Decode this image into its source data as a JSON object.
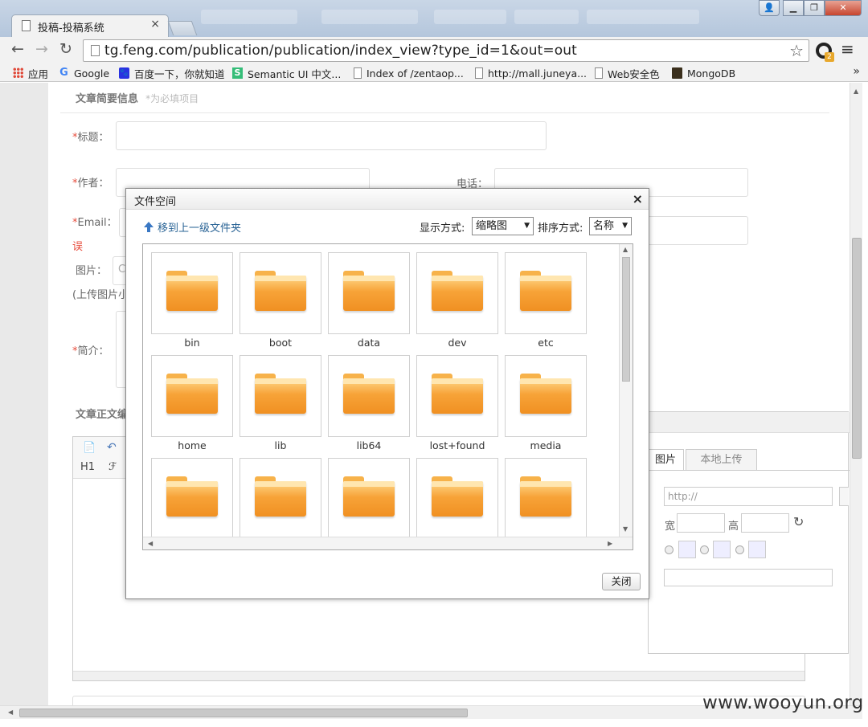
{
  "browser": {
    "tab_title": "投稿-投稿系统",
    "url": "tg.feng.com/publication/publication/index_view?type_id=1&out=out",
    "bookmarks": [
      {
        "label": "应用",
        "icon": "apps-grid-icon"
      },
      {
        "label": "Google",
        "icon": "google-icon"
      },
      {
        "label": "百度一下，你就知道",
        "icon": "baidu-icon"
      },
      {
        "label": "Semantic UI 中文...",
        "icon": "semantic-ui-icon"
      },
      {
        "label": "Index of /zentaop...",
        "icon": "page-icon"
      },
      {
        "label": "http://mall.juneya...",
        "icon": "page-icon"
      },
      {
        "label": "Web安全色",
        "icon": "page-icon"
      },
      {
        "label": "MongoDB",
        "icon": "mongodb-icon"
      }
    ],
    "bookmarks_more": "»"
  },
  "form": {
    "section_title": "文章简要信息",
    "section_hint": "*为必填项目",
    "title_label": "标题：",
    "author_label": "作者：",
    "phone_label": "电话：",
    "email_label": "Email：",
    "error_text": "误",
    "image_label": "图片：",
    "image_input_partial": "C",
    "upload_hint_partial": "(上传图片小",
    "intro_label": "简介：",
    "body_section_partial": "文章正文编",
    "editor_heading_btn": "H1",
    "editor_font_btn": "ℱ"
  },
  "image_dialog": {
    "tab_network_partial": "图片",
    "tab_local_upload": "本地上传",
    "url_placeholder": "http://",
    "width_label": "宽",
    "height_label": "高"
  },
  "file_dialog": {
    "title": "文件空间",
    "close_glyph": "×",
    "up_folder": "移到上一级文件夹",
    "view_mode_label": "显示方式:",
    "view_mode_value": "缩略图",
    "sort_label": "排序方式:",
    "sort_value": "名称",
    "folders": [
      "bin",
      "boot",
      "data",
      "dev",
      "etc",
      "home",
      "lib",
      "lib64",
      "lost+found",
      "media",
      "",
      "",
      "",
      "",
      ""
    ],
    "close_button": "关闭"
  },
  "watermark": "www.wooyun.org"
}
